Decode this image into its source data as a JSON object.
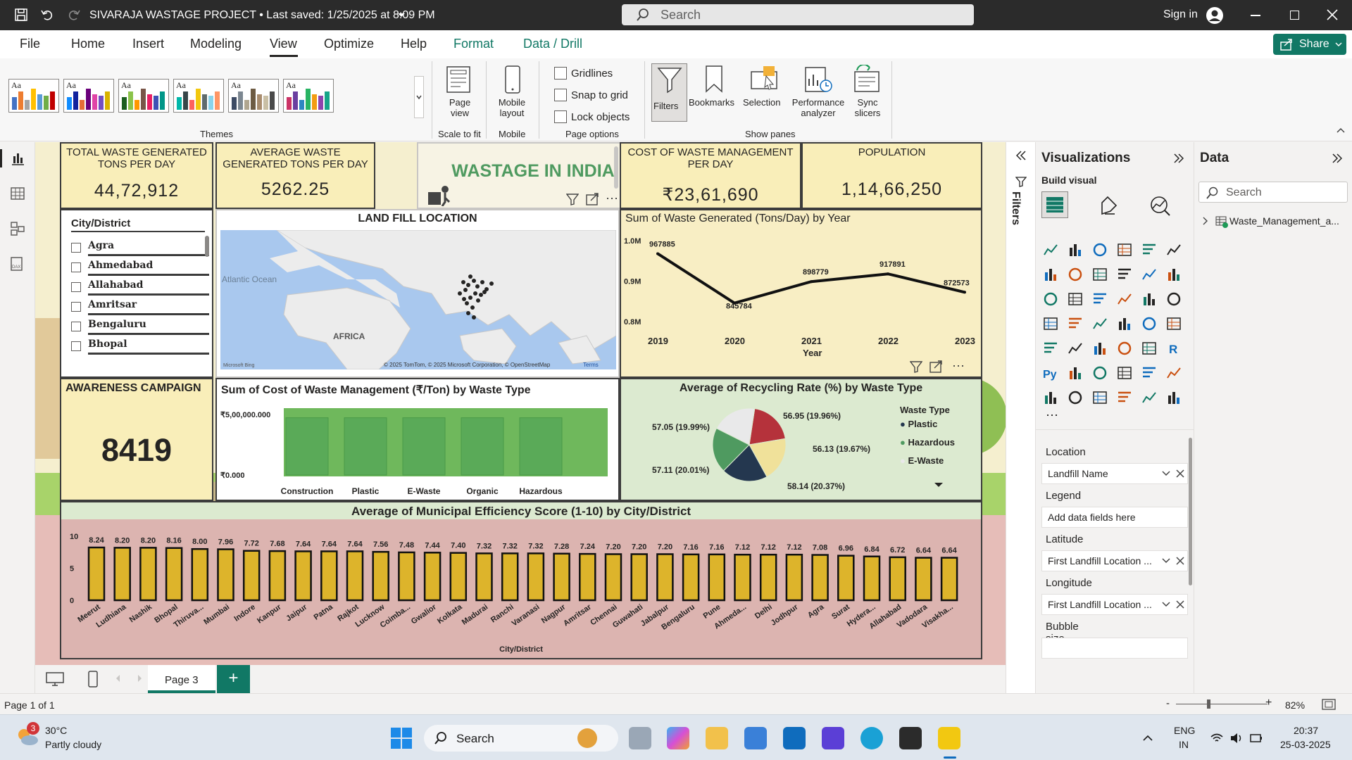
{
  "window": {
    "title": "SIVARAJA WASTAGE PROJECT",
    "saved": "Last saved: 1/25/2025 at 8:09 PM",
    "search_placeholder": "Search",
    "signin": "Sign in"
  },
  "menu": {
    "items": [
      "File",
      "Home",
      "Insert",
      "Modeling",
      "View",
      "Optimize",
      "Help",
      "Format",
      "Data / Drill"
    ],
    "active": "View",
    "share": "Share"
  },
  "ribbon": {
    "themes_label": "Themes",
    "theme_sample": "Aa",
    "page_view": "Page view",
    "scale_to_fit": "Scale to fit",
    "mobile_layout": "Mobile layout",
    "mobile": "Mobile",
    "gridlines": "Gridlines",
    "snap": "Snap to grid",
    "lock": "Lock objects",
    "page_options": "Page options",
    "filters": "Filters",
    "bookmarks": "Bookmarks",
    "selection": "Selection",
    "performance": "Performance analyzer",
    "sync": "Sync slicers",
    "show_panes": "Show panes"
  },
  "kpis": {
    "total_waste_title": "TOTAL WASTE GENERATED TONS PER DAY",
    "total_waste_value": "44,72,912",
    "avg_waste_title": "AVERAGE WASTE GENERATED TONS PER DAY",
    "avg_waste_value": "5262.25",
    "banner": "WASTAGE IN INDIA",
    "cost_title": "COST OF WASTE MANAGEMENT PER DAY",
    "cost_value": "₹23,61,690",
    "population_title": "POPULATION",
    "population_value": "1,14,66,250",
    "awareness_title": "AWARENESS CAMPAIGN",
    "awareness_value": "8419"
  },
  "slicer": {
    "title": "City/District",
    "items": [
      "Agra",
      "Ahmedabad",
      "Allahabad",
      "Amritsar",
      "Bengaluru",
      "Bhopal"
    ]
  },
  "map": {
    "title": "LAND FILL LOCATION",
    "ocean": "Atlantic Ocean",
    "continent": "AFRICA",
    "copyright": "© 2025 TomTom, © 2025 Microsoft Corporation, © OpenStreetMap",
    "terms": "Terms",
    "brand": "Microsoft Bing"
  },
  "line_chart_meta": {
    "title": "Sum of Waste Generated (Tons/Day) by Year",
    "xlabel": "Year"
  },
  "bar_cost_meta": {
    "title": "Sum of Cost of Waste Management (₹/Ton) by Waste Type"
  },
  "pie_meta": {
    "title": "Average of Recycling Rate (%) by Waste Type",
    "legend_title": "Waste Type",
    "legend": [
      "Plastic",
      "Hazardous",
      "E-Waste"
    ]
  },
  "muni_meta": {
    "title": "Average of Municipal Efficiency Score (1-10) by City/District",
    "xlabel": "City/District"
  },
  "chart_data": [
    {
      "type": "line",
      "title": "Sum of Waste Generated (Tons/Day) by Year",
      "xlabel": "Year",
      "x": [
        "2019",
        "2020",
        "2021",
        "2022",
        "2023"
      ],
      "series": [
        {
          "values": [
            967885,
            845784,
            898779,
            917891,
            872573
          ]
        }
      ],
      "value_labels": [
        "967885",
        "845784",
        "898779",
        "917891",
        "872573"
      ],
      "yticks": [
        "1.0M",
        "0.9M",
        "0.8M"
      ],
      "ylim": [
        800000,
        1000000
      ]
    },
    {
      "type": "bar",
      "title": "Sum of Cost of Waste Management (₹/Ton) by Waste Type",
      "categories": [
        "Construction",
        "Plastic",
        "E-Waste",
        "Organic",
        "Hazardous"
      ],
      "values": [
        473000,
        473000,
        473000,
        473000,
        473000
      ],
      "yticks": [
        "₹5,00,000.000",
        "₹0.000"
      ],
      "ylim": [
        0,
        500000
      ]
    },
    {
      "type": "pie",
      "title": "Average of Recycling Rate (%) by Waste Type",
      "slices": [
        {
          "label": "56.95 (19.96%)",
          "value": 56.95,
          "color": "#b5323b"
        },
        {
          "label": "56.13 (19.67%)",
          "value": 56.13,
          "color": "#f0e19a"
        },
        {
          "label": "58.14 (20.37%)",
          "value": 58.14,
          "color": "#24374f"
        },
        {
          "label": "57.11 (20.01%)",
          "value": 57.11,
          "color": "#4f9a60"
        },
        {
          "label": "57.05 (19.99%)",
          "value": 57.05,
          "color": "#e9e9ea"
        }
      ]
    },
    {
      "type": "bar",
      "title": "Average of Municipal Efficiency Score (1-10) by City/District",
      "xlabel": "City/District",
      "categories": [
        "Meerut",
        "Ludhiana",
        "Nashik",
        "Bhopal",
        "Thiruva...",
        "Mumbai",
        "Indore",
        "Kanpur",
        "Jaipur",
        "Patna",
        "Rajkot",
        "Lucknow",
        "Coimba...",
        "Gwalior",
        "Kolkata",
        "Madurai",
        "Ranchi",
        "Varanasi",
        "Nagpur",
        "Amritsar",
        "Chennai",
        "Guwahati",
        "Jabalpur",
        "Bengaluru",
        "Pune",
        "Ahmeda...",
        "Delhi",
        "Jodhpur",
        "Agra",
        "Surat",
        "Hydera...",
        "Allahabad",
        "Vadodara",
        "Visakha..."
      ],
      "values": [
        8.24,
        8.2,
        8.2,
        8.16,
        8.0,
        7.96,
        7.72,
        7.68,
        7.64,
        7.64,
        7.64,
        7.56,
        7.48,
        7.44,
        7.4,
        7.32,
        7.32,
        7.32,
        7.28,
        7.24,
        7.2,
        7.2,
        7.2,
        7.16,
        7.16,
        7.12,
        7.12,
        7.12,
        7.08,
        6.96,
        6.84,
        6.72,
        6.64,
        6.64
      ],
      "labels": [
        "8.24",
        "8.20",
        "8.20",
        "8.16",
        "8.00",
        "7.96",
        "7.72",
        "7.68",
        "7.64",
        "7.64",
        "7.64",
        "7.56",
        "7.48",
        "7.44",
        "7.40",
        "7.32",
        "7.32",
        "7.32",
        "7.28",
        "7.24",
        "7.20",
        "7.20",
        "7.20",
        "7.16",
        "7.16",
        "7.12",
        "7.12",
        "7.12",
        "7.08",
        "6.96",
        "6.84",
        "6.72",
        "6.64",
        "6.64"
      ],
      "yticks": [
        "10",
        "5",
        "0"
      ],
      "ylim": [
        0,
        10
      ]
    }
  ],
  "panes": {
    "filters": "Filters",
    "visualizations": "Visualizations",
    "build_visual": "Build visual",
    "data": "Data",
    "data_search": "Search",
    "table": "Waste_Management_a...",
    "wells": [
      {
        "label": "Location",
        "field": "Landfill Name"
      },
      {
        "label": "Legend",
        "field": "Add data fields here"
      },
      {
        "label": "Latitude",
        "field": "First Landfill Location ..."
      },
      {
        "label": "Longitude",
        "field": "First Landfill Location ..."
      },
      {
        "label": "Bubble size",
        "field": ""
      }
    ]
  },
  "pages": {
    "current": "Page 3",
    "status": "Page 1 of 1",
    "zoom": "82%"
  },
  "taskbar": {
    "temp": "30°C",
    "weather": "Partly cloudy",
    "search": "Search",
    "lang1": "ENG",
    "lang2": "IN",
    "time": "20:37",
    "date": "25-03-2025",
    "badge": "3"
  }
}
